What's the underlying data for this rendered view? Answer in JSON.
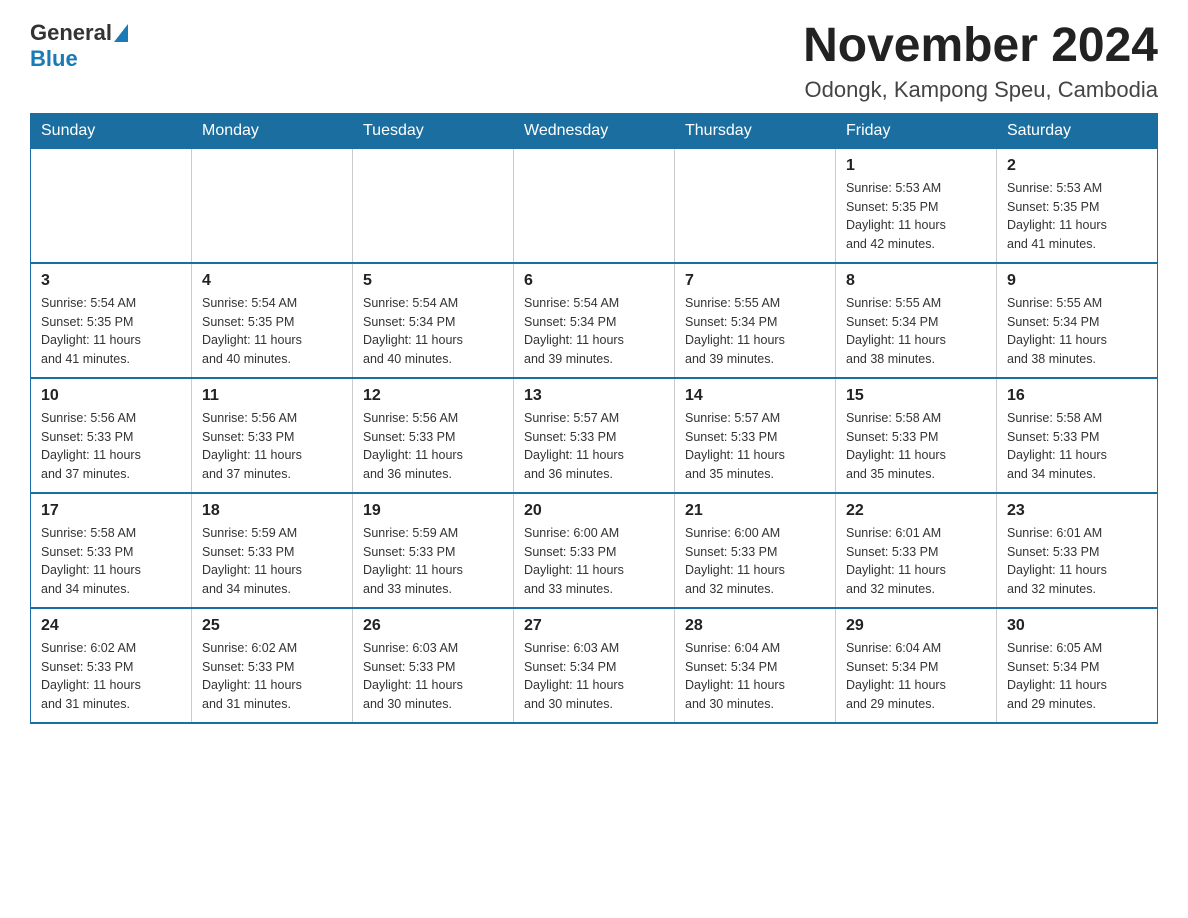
{
  "logo": {
    "general": "General",
    "blue": "Blue"
  },
  "title": "November 2024",
  "subtitle": "Odongk, Kampong Speu, Cambodia",
  "weekdays": [
    "Sunday",
    "Monday",
    "Tuesday",
    "Wednesday",
    "Thursday",
    "Friday",
    "Saturday"
  ],
  "weeks": [
    [
      {
        "day": "",
        "info": ""
      },
      {
        "day": "",
        "info": ""
      },
      {
        "day": "",
        "info": ""
      },
      {
        "day": "",
        "info": ""
      },
      {
        "day": "",
        "info": ""
      },
      {
        "day": "1",
        "info": "Sunrise: 5:53 AM\nSunset: 5:35 PM\nDaylight: 11 hours\nand 42 minutes."
      },
      {
        "day": "2",
        "info": "Sunrise: 5:53 AM\nSunset: 5:35 PM\nDaylight: 11 hours\nand 41 minutes."
      }
    ],
    [
      {
        "day": "3",
        "info": "Sunrise: 5:54 AM\nSunset: 5:35 PM\nDaylight: 11 hours\nand 41 minutes."
      },
      {
        "day": "4",
        "info": "Sunrise: 5:54 AM\nSunset: 5:35 PM\nDaylight: 11 hours\nand 40 minutes."
      },
      {
        "day": "5",
        "info": "Sunrise: 5:54 AM\nSunset: 5:34 PM\nDaylight: 11 hours\nand 40 minutes."
      },
      {
        "day": "6",
        "info": "Sunrise: 5:54 AM\nSunset: 5:34 PM\nDaylight: 11 hours\nand 39 minutes."
      },
      {
        "day": "7",
        "info": "Sunrise: 5:55 AM\nSunset: 5:34 PM\nDaylight: 11 hours\nand 39 minutes."
      },
      {
        "day": "8",
        "info": "Sunrise: 5:55 AM\nSunset: 5:34 PM\nDaylight: 11 hours\nand 38 minutes."
      },
      {
        "day": "9",
        "info": "Sunrise: 5:55 AM\nSunset: 5:34 PM\nDaylight: 11 hours\nand 38 minutes."
      }
    ],
    [
      {
        "day": "10",
        "info": "Sunrise: 5:56 AM\nSunset: 5:33 PM\nDaylight: 11 hours\nand 37 minutes."
      },
      {
        "day": "11",
        "info": "Sunrise: 5:56 AM\nSunset: 5:33 PM\nDaylight: 11 hours\nand 37 minutes."
      },
      {
        "day": "12",
        "info": "Sunrise: 5:56 AM\nSunset: 5:33 PM\nDaylight: 11 hours\nand 36 minutes."
      },
      {
        "day": "13",
        "info": "Sunrise: 5:57 AM\nSunset: 5:33 PM\nDaylight: 11 hours\nand 36 minutes."
      },
      {
        "day": "14",
        "info": "Sunrise: 5:57 AM\nSunset: 5:33 PM\nDaylight: 11 hours\nand 35 minutes."
      },
      {
        "day": "15",
        "info": "Sunrise: 5:58 AM\nSunset: 5:33 PM\nDaylight: 11 hours\nand 35 minutes."
      },
      {
        "day": "16",
        "info": "Sunrise: 5:58 AM\nSunset: 5:33 PM\nDaylight: 11 hours\nand 34 minutes."
      }
    ],
    [
      {
        "day": "17",
        "info": "Sunrise: 5:58 AM\nSunset: 5:33 PM\nDaylight: 11 hours\nand 34 minutes."
      },
      {
        "day": "18",
        "info": "Sunrise: 5:59 AM\nSunset: 5:33 PM\nDaylight: 11 hours\nand 34 minutes."
      },
      {
        "day": "19",
        "info": "Sunrise: 5:59 AM\nSunset: 5:33 PM\nDaylight: 11 hours\nand 33 minutes."
      },
      {
        "day": "20",
        "info": "Sunrise: 6:00 AM\nSunset: 5:33 PM\nDaylight: 11 hours\nand 33 minutes."
      },
      {
        "day": "21",
        "info": "Sunrise: 6:00 AM\nSunset: 5:33 PM\nDaylight: 11 hours\nand 32 minutes."
      },
      {
        "day": "22",
        "info": "Sunrise: 6:01 AM\nSunset: 5:33 PM\nDaylight: 11 hours\nand 32 minutes."
      },
      {
        "day": "23",
        "info": "Sunrise: 6:01 AM\nSunset: 5:33 PM\nDaylight: 11 hours\nand 32 minutes."
      }
    ],
    [
      {
        "day": "24",
        "info": "Sunrise: 6:02 AM\nSunset: 5:33 PM\nDaylight: 11 hours\nand 31 minutes."
      },
      {
        "day": "25",
        "info": "Sunrise: 6:02 AM\nSunset: 5:33 PM\nDaylight: 11 hours\nand 31 minutes."
      },
      {
        "day": "26",
        "info": "Sunrise: 6:03 AM\nSunset: 5:33 PM\nDaylight: 11 hours\nand 30 minutes."
      },
      {
        "day": "27",
        "info": "Sunrise: 6:03 AM\nSunset: 5:34 PM\nDaylight: 11 hours\nand 30 minutes."
      },
      {
        "day": "28",
        "info": "Sunrise: 6:04 AM\nSunset: 5:34 PM\nDaylight: 11 hours\nand 30 minutes."
      },
      {
        "day": "29",
        "info": "Sunrise: 6:04 AM\nSunset: 5:34 PM\nDaylight: 11 hours\nand 29 minutes."
      },
      {
        "day": "30",
        "info": "Sunrise: 6:05 AM\nSunset: 5:34 PM\nDaylight: 11 hours\nand 29 minutes."
      }
    ]
  ]
}
